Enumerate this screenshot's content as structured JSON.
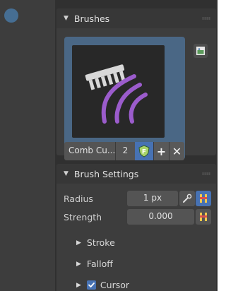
{
  "colors": {
    "accent": "#4772b3",
    "brush_tint": "#9b5ccc",
    "panel_bg": "#3d3d3d"
  },
  "brushes_panel": {
    "title": "Brushes",
    "expanded": true,
    "thumbnail_icon": "comb-brush-icon",
    "brush_name": "Comb Cu...",
    "users": "2",
    "fake_user_icon": "fake-user-shield-icon",
    "new_icon": "plus-icon",
    "unlink_icon": "close-icon",
    "add_image_icon": "image-add-icon"
  },
  "brush_settings": {
    "title": "Brush Settings",
    "expanded": true,
    "radius": {
      "label": "Radius",
      "value": "1 px"
    },
    "strength": {
      "label": "Strength",
      "value": "0.000"
    },
    "subpanels": [
      {
        "label": "Stroke",
        "expanded": false
      },
      {
        "label": "Falloff",
        "expanded": false
      },
      {
        "label": "Cursor",
        "expanded": false,
        "checked": true
      }
    ]
  }
}
